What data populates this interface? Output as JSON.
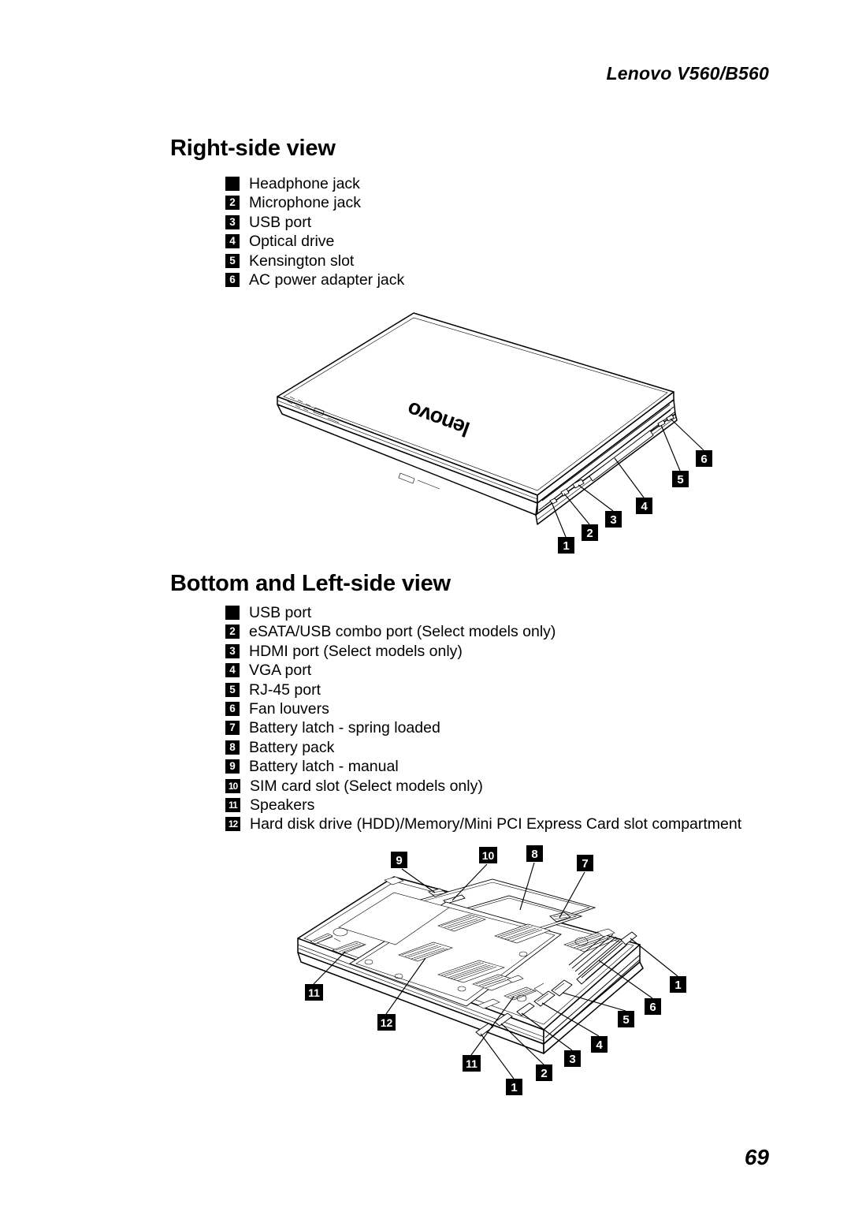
{
  "header": {
    "running_title": "Lenovo V560/B560"
  },
  "sections": [
    {
      "id": "right-side",
      "heading": "Right-side view",
      "items": [
        {
          "num": "",
          "label": "Headphone jack"
        },
        {
          "num": "2",
          "label": "Microphone jack"
        },
        {
          "num": "3",
          "label": "USB port"
        },
        {
          "num": "4",
          "label": "Optical drive"
        },
        {
          "num": "5",
          "label": "Kensington slot"
        },
        {
          "num": "6",
          "label": "AC power adapter jack"
        }
      ],
      "figure": {
        "name": "right-side-view-illustration",
        "description": "Closed notebook computer seen from above right with lenovo logo on lid",
        "callouts": [
          "1",
          "2",
          "3",
          "4",
          "5",
          "6"
        ]
      }
    },
    {
      "id": "bottom-left-side",
      "heading": "Bottom and Left-side view",
      "items": [
        {
          "num": "",
          "label": "USB port"
        },
        {
          "num": "2",
          "label": "eSATA/USB combo port (Select models only)"
        },
        {
          "num": "3",
          "label": "HDMI port (Select models only)"
        },
        {
          "num": "4",
          "label": "VGA port"
        },
        {
          "num": "5",
          "label": "RJ-45 port"
        },
        {
          "num": "6",
          "label": "Fan louvers"
        },
        {
          "num": "7",
          "label": "Battery latch - spring loaded"
        },
        {
          "num": "8",
          "label": "Battery pack"
        },
        {
          "num": "9",
          "label": "Battery latch - manual"
        },
        {
          "num": "10",
          "label": "SIM card slot (Select models only)"
        },
        {
          "num": "11",
          "label": "Speakers"
        },
        {
          "num": "12",
          "label": "Hard disk drive (HDD)/Memory/Mini PCI Express Card slot compartment"
        }
      ],
      "figure": {
        "name": "bottom-and-left-side-view-illustration",
        "description": "Notebook computer underside seen from below right showing battery bay, vents and left-edge ports",
        "callouts": [
          "9",
          "10",
          "8",
          "7",
          "11",
          "12",
          "11",
          "1",
          "2",
          "3",
          "4",
          "5",
          "6",
          "1"
        ]
      }
    }
  ],
  "brand": {
    "lid_logo": "lenovo"
  },
  "folio": {
    "page_number": "69"
  },
  "colors": {
    "ink": "#000000",
    "paper": "#ffffff",
    "callout_bg": "#000000",
    "callout_fg": "#ffffff"
  }
}
